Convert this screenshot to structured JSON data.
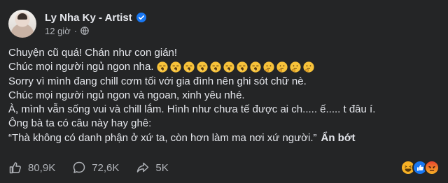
{
  "post": {
    "author": "Ly Nha Ky - Artist",
    "time": "12 giờ",
    "separator": "·",
    "lines": [
      "Chuyện cũ quá! Chán như con gián!",
      "Chúc mọi người ngủ ngon nha.",
      "Sorry vì mình đang chill cơm tối với gia đình nên ghi sót chữ nè.",
      "Chúc mọi người ngủ ngon và ngoan, xinh yêu nhé.",
      "À, mình vẫn sống vui và chill lắm. Hình như chưa tế được ai ch..... ế..... t đâu í.",
      "Ông bà ta có câu này hay ghê:",
      "“Thà không có danh phận ở xứ ta, còn hơn làm ma nơi xứ người.”"
    ],
    "see_less": "Ẩn bớt",
    "emoji_names": [
      "yawning-face-icon",
      "yawning-face-icon",
      "yawning-face-icon",
      "yawning-face-icon",
      "yawning-face-icon",
      "yawning-face-icon",
      "yawning-face-icon",
      "yawning-face-icon",
      "thinking-face-icon",
      "thinking-face-icon",
      "thinking-face-icon",
      "thinking-face-icon"
    ]
  },
  "actions": {
    "likes": "80,9K",
    "comments": "72,6K",
    "shares": "5K"
  },
  "reactions": [
    "haha-icon",
    "like-icon",
    "angry-icon"
  ],
  "colors": {
    "background": "#242526",
    "text": "#e4e6eb",
    "secondary": "#b0b3b8",
    "verified": "#1877f2"
  }
}
